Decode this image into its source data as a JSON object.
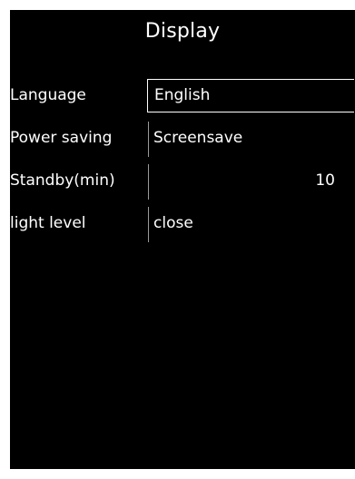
{
  "screen": {
    "title": "Display"
  },
  "settings": {
    "language": {
      "label": "Language",
      "value": "English",
      "selected": true
    },
    "power_saving": {
      "label": "Power saving",
      "value": "Screensave"
    },
    "standby": {
      "label": "Standby(min)",
      "value": "10"
    },
    "light_level": {
      "label": "light level",
      "value": "close"
    }
  },
  "colors": {
    "background": "#000000",
    "text": "#ffffff",
    "divider": "#9a9a9a"
  }
}
